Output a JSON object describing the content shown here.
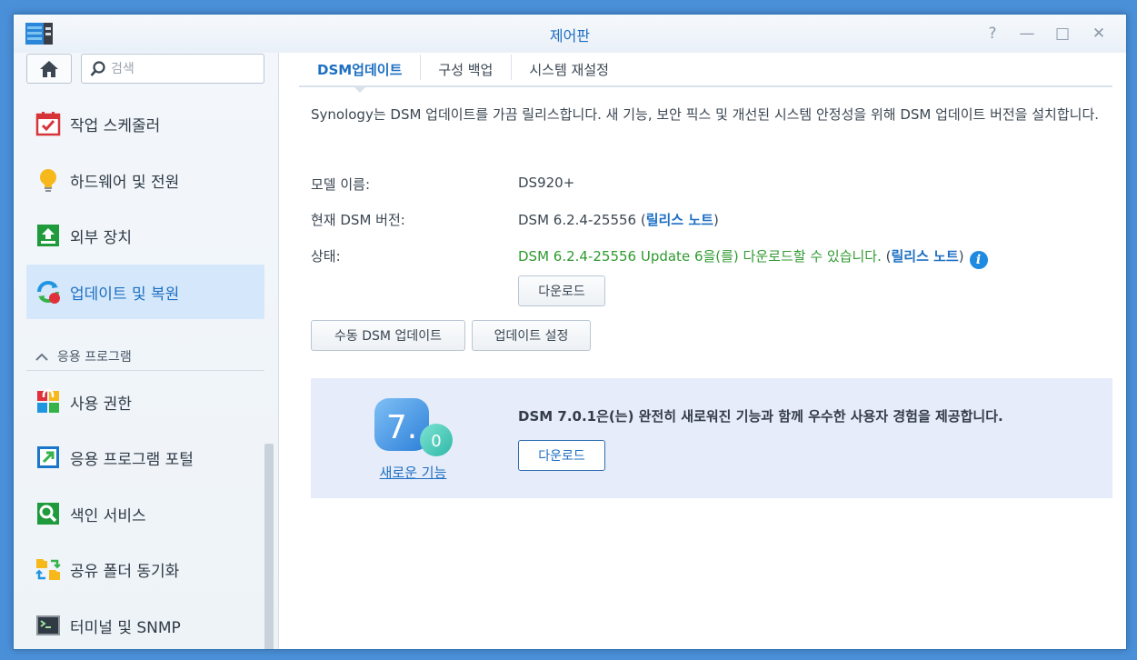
{
  "window": {
    "title": "제어판",
    "controls": {
      "help": "?",
      "minimize": "—",
      "maximize": "□",
      "close": "✕"
    }
  },
  "sidebar": {
    "search_placeholder": "검색",
    "items_top": [
      {
        "label": "작업 스케줄러",
        "icon": "task-scheduler-icon"
      },
      {
        "label": "하드웨어 및 전원",
        "icon": "lightbulb-icon"
      },
      {
        "label": "외부 장치",
        "icon": "external-device-icon"
      },
      {
        "label": "업데이트 및 복원",
        "icon": "update-restore-icon",
        "active": true
      }
    ],
    "section_label": "응용 프로그램",
    "items_apps": [
      {
        "label": "사용 권한",
        "icon": "privileges-icon"
      },
      {
        "label": "응용 프로그램 포털",
        "icon": "app-portal-icon"
      },
      {
        "label": "색인 서비스",
        "icon": "indexing-service-icon"
      },
      {
        "label": "공유 폴더 동기화",
        "icon": "shared-folder-sync-icon"
      },
      {
        "label": "터미널 및 SNMP",
        "icon": "terminal-icon"
      }
    ]
  },
  "tabs": [
    {
      "label": "DSM업데이트",
      "active": true
    },
    {
      "label": "구성 백업"
    },
    {
      "label": "시스템 재설정"
    }
  ],
  "main": {
    "description": "Synology는 DSM 업데이트를 가끔 릴리스합니다. 새 기능, 보안 픽스 및 개선된 시스템 안정성을 위해 DSM 업데이트 버전을 설치합니다.",
    "model_label": "모델 이름:",
    "model_value": "DS920+",
    "version_label": "현재 DSM 버전:",
    "version_value": "DSM 6.2.4-25556",
    "release_notes": "릴리스 노트",
    "status_label": "상태:",
    "status_value": "DSM 6.2.4-25556 Update 6을(를) 다운로드할 수 있습니다.",
    "download_button": "다운로드",
    "manual_update_button": "수동 DSM 업데이트",
    "update_settings_button": "업데이트 설정"
  },
  "promo": {
    "badge_major": "7.",
    "badge_minor": "0",
    "link": "새로운 기능",
    "text": "DSM 7.0.1은(는) 완전히 새로워진 기능과 함께 우수한 사용자 경험을 제공합니다.",
    "download_button": "다운로드"
  }
}
